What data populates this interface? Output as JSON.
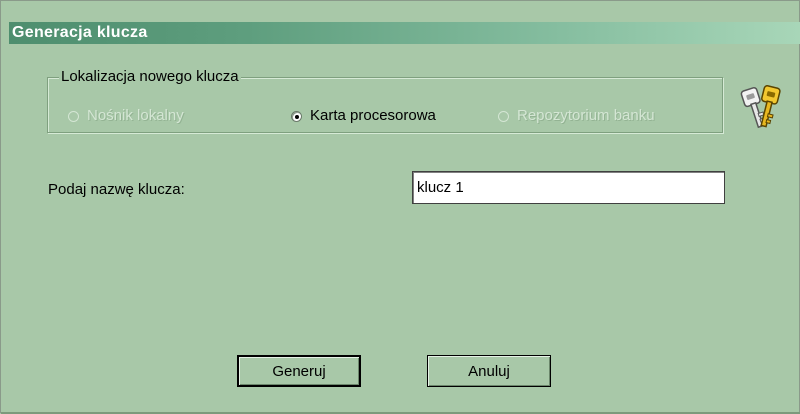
{
  "window": {
    "title": "Generacja klucza"
  },
  "location_group": {
    "legend": "Lokalizacja nowego klucza",
    "options": [
      {
        "label": "Nośnik lokalny",
        "checked": false,
        "enabled": false
      },
      {
        "label": "Karta procesorowa",
        "checked": true,
        "enabled": true
      },
      {
        "label": "Repozytorium banku",
        "checked": false,
        "enabled": false
      }
    ]
  },
  "key_name": {
    "label": "Podaj nazwę klucza:",
    "value": "klucz 1"
  },
  "buttons": {
    "generate": "Generuj",
    "cancel": "Anuluj"
  },
  "icon": "keys-icon",
  "colors": {
    "background": "#a8c8a8",
    "title_start": "#4e8e6e",
    "title_end": "#a8d6b8"
  }
}
